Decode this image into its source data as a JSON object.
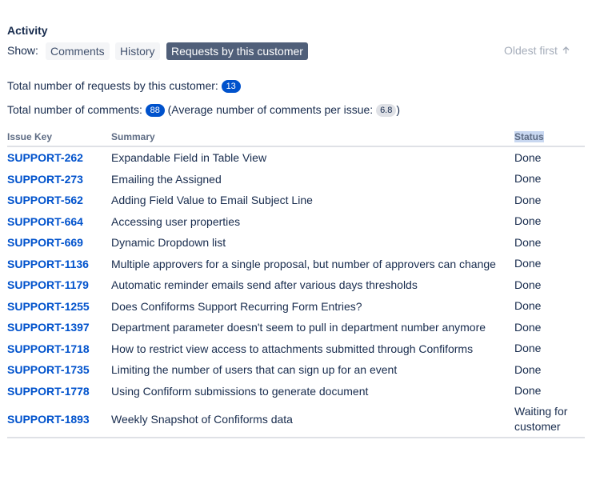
{
  "activity": {
    "heading": "Activity",
    "show_label": "Show:",
    "tabs": [
      {
        "label": "Comments",
        "active": false
      },
      {
        "label": "History",
        "active": false
      },
      {
        "label": "Requests by this customer",
        "active": true
      }
    ],
    "sort_label": "Oldest first",
    "sort_icon": "arrow-up-icon"
  },
  "stats": {
    "requests_label": "Total number of requests by this customer:",
    "requests_count": "13",
    "comments_label": "Total number of comments:",
    "comments_count": "88",
    "avg_label_open": "(Average number of comments per issue:",
    "avg_value": "6.8",
    "avg_label_close": ")"
  },
  "table": {
    "headers": {
      "key": "Issue Key",
      "summary": "Summary",
      "status": "Status"
    },
    "rows": [
      {
        "key": "SUPPORT-262",
        "summary": "Expandable Field in Table View",
        "status": "Done"
      },
      {
        "key": "SUPPORT-273",
        "summary": "Emailing the Assigned",
        "status": "Done"
      },
      {
        "key": "SUPPORT-562",
        "summary": "Adding Field Value to Email Subject Line",
        "status": "Done"
      },
      {
        "key": "SUPPORT-664",
        "summary": "Accessing user properties",
        "status": "Done"
      },
      {
        "key": "SUPPORT-669",
        "summary": "Dynamic Dropdown list",
        "status": "Done"
      },
      {
        "key": "SUPPORT-1136",
        "summary": "Multiple approvers for a single proposal, but number of approvers can change",
        "status": "Done"
      },
      {
        "key": "SUPPORT-1179",
        "summary": "Automatic reminder emails send after various days thresholds",
        "status": "Done"
      },
      {
        "key": "SUPPORT-1255",
        "summary": "Does Confiforms Support Recurring Form Entries?",
        "status": "Done"
      },
      {
        "key": "SUPPORT-1397",
        "summary": "Department parameter doesn't seem to pull in department number anymore",
        "status": "Done"
      },
      {
        "key": "SUPPORT-1718",
        "summary": "How to restrict view access to attachments submitted through Confiforms",
        "status": "Done"
      },
      {
        "key": "SUPPORT-1735",
        "summary": "Limiting the number of users that can sign up for an event",
        "status": "Done"
      },
      {
        "key": "SUPPORT-1778",
        "summary": "Using Confiform submissions to generate document",
        "status": "Done"
      },
      {
        "key": "SUPPORT-1893",
        "summary": "Weekly Snapshot of Confiforms data",
        "status": "Waiting for customer"
      }
    ]
  }
}
